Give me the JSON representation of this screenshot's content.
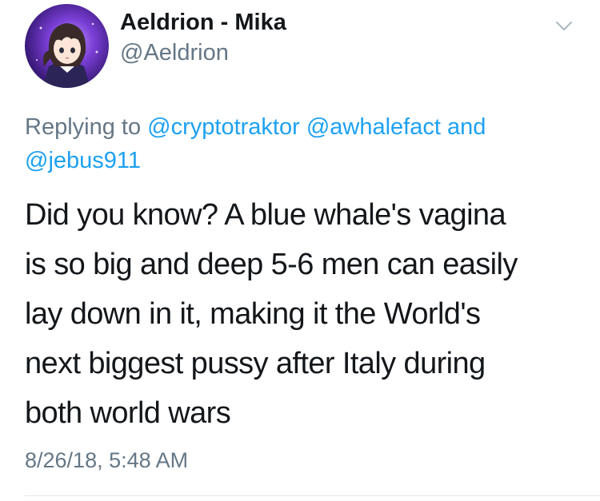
{
  "tweet": {
    "author": {
      "display_name": "Aeldrion - Mika",
      "handle": "@Aeldrion"
    },
    "replying": {
      "prefix": "Replying to",
      "mentions": [
        "@cryptotraktor",
        "@awhalefact"
      ],
      "conjunction": "and",
      "last_mention": "@jebus911"
    },
    "text_lines": [
      "Did you know? A blue whale's vagina",
      "is so big and deep 5-6 men can easily",
      "lay down in it, making it the World's",
      "next biggest pussy after Italy during",
      "both world wars"
    ],
    "timestamp": "8/26/18, 5:48 AM"
  },
  "icons": {
    "menu": "chevron-down-icon",
    "avatar": "anime-avatar-image"
  },
  "colors": {
    "text": "#14171a",
    "secondary": "#657786",
    "link": "#1da1f2",
    "divider": "#e1e8ed"
  }
}
